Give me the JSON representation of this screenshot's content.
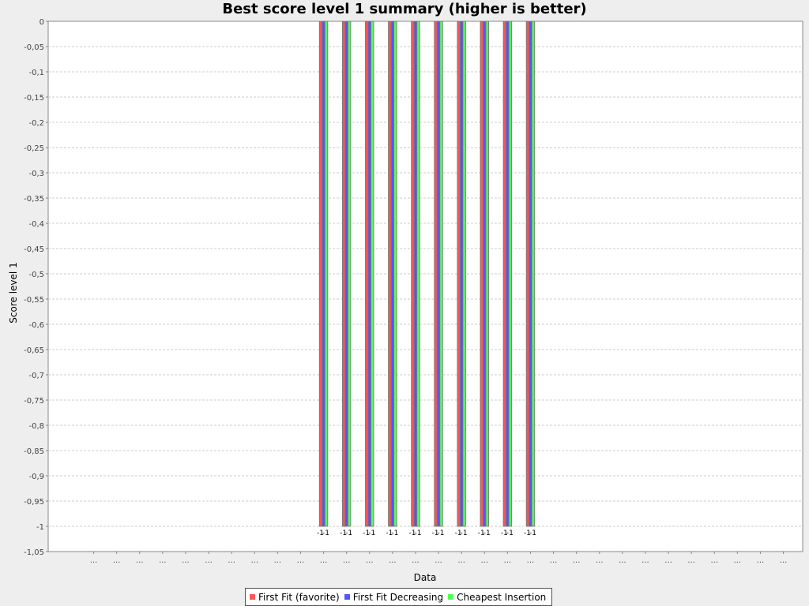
{
  "chart_data": {
    "type": "bar",
    "title": "Best score level 1 summary (higher is better)",
    "xlabel": "Data",
    "ylabel": "Score level 1",
    "ylim": [
      -1.05,
      0
    ],
    "yticks": [
      "0",
      "-0,05",
      "-0,1",
      "-0,15",
      "-0,2",
      "-0,25",
      "-0,3",
      "-0,35",
      "-0,4",
      "-0,45",
      "-0,5",
      "-0,55",
      "-0,6",
      "-0,65",
      "-0,7",
      "-0,75",
      "-0,8",
      "-0,85",
      "-0,9",
      "-0,95",
      "-1",
      "-1,05"
    ],
    "grid": true,
    "legend_position": "bottom",
    "categories": [
      "...",
      "...",
      "...",
      "...",
      "...",
      "...",
      "...",
      "...",
      "...",
      "...",
      "...",
      "...",
      "...",
      "...",
      "...",
      "...",
      "...",
      "...",
      "...",
      "...",
      "...",
      "...",
      "...",
      "...",
      "...",
      "...",
      "...",
      "...",
      "...",
      "...",
      "..."
    ],
    "series": [
      {
        "name": "First Fit (favorite)",
        "color": "#ff5555",
        "values": [
          null,
          null,
          null,
          null,
          null,
          null,
          null,
          null,
          null,
          null,
          -1,
          -1,
          -1,
          -1,
          -1,
          -1,
          -1,
          -1,
          -1,
          -1,
          null,
          null,
          null,
          null,
          null,
          null,
          null,
          null,
          null,
          null,
          null
        ]
      },
      {
        "name": "First Fit Decreasing",
        "color": "#5555ff",
        "values": [
          null,
          null,
          null,
          null,
          null,
          null,
          null,
          null,
          null,
          null,
          -1,
          -1,
          -1,
          -1,
          -1,
          -1,
          -1,
          -1,
          -1,
          -1,
          null,
          null,
          null,
          null,
          null,
          null,
          null,
          null,
          null,
          null,
          null
        ]
      },
      {
        "name": "Cheapest Insertion",
        "color": "#55ff55",
        "values": [
          null,
          null,
          null,
          null,
          null,
          null,
          null,
          null,
          null,
          null,
          -1,
          -1,
          -1,
          -1,
          -1,
          -1,
          -1,
          -1,
          -1,
          -1,
          null,
          null,
          null,
          null,
          null,
          null,
          null,
          null,
          null,
          null,
          null
        ]
      }
    ],
    "data_labels": [
      "-1",
      "-1",
      "-1",
      "-1",
      "-1",
      "-1",
      "-1",
      "-1",
      "-1",
      "-1"
    ]
  }
}
